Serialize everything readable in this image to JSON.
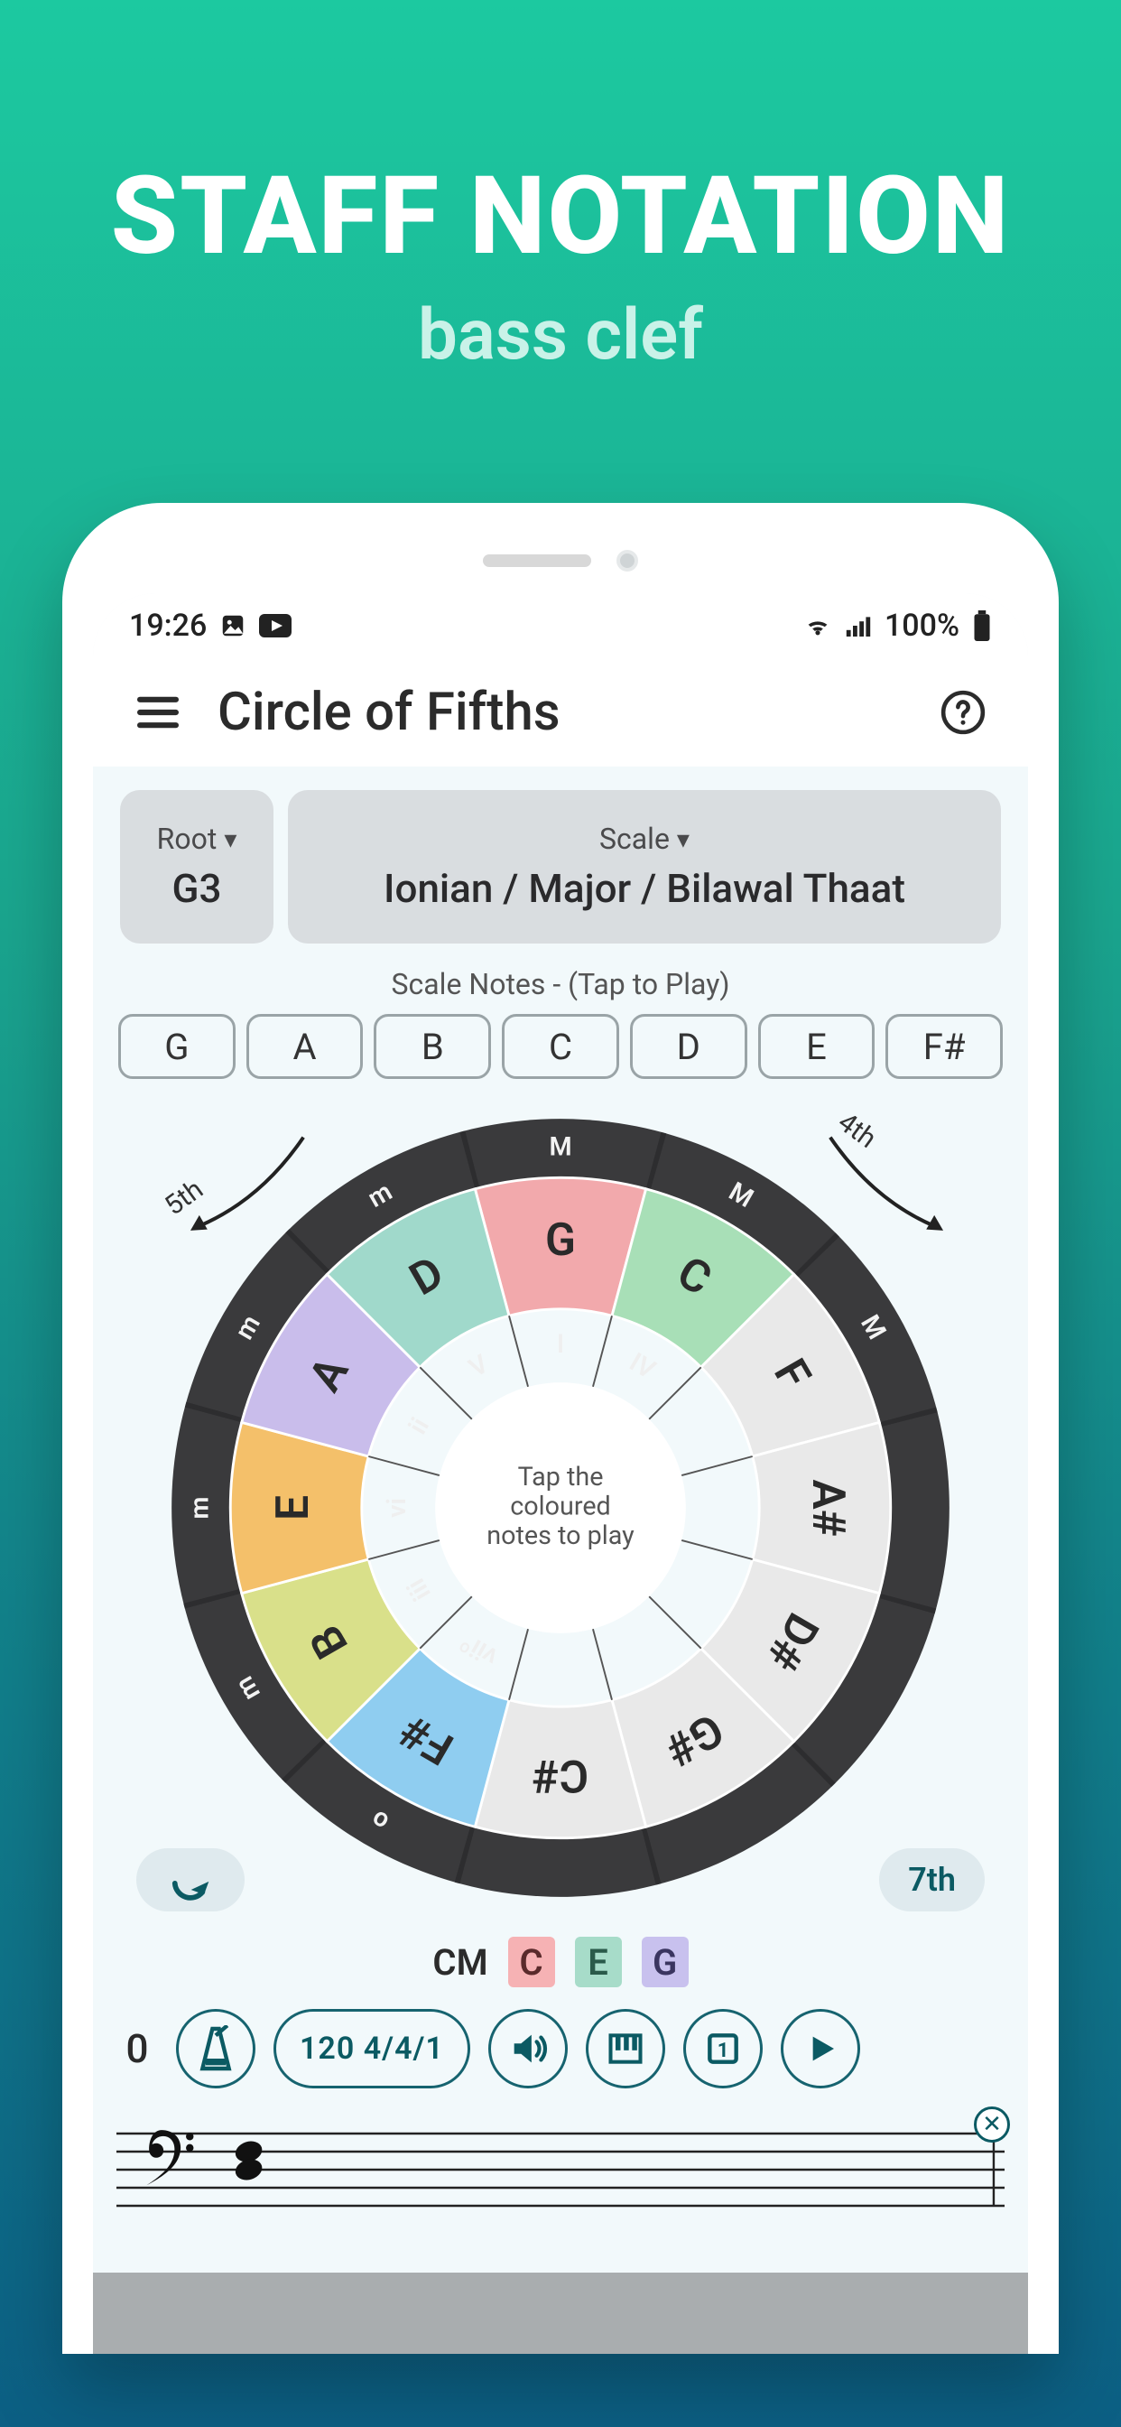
{
  "promo": {
    "title": "STAFF NOTATION",
    "subtitle": "bass clef"
  },
  "status": {
    "time": "19:26",
    "battery": "100%"
  },
  "appbar": {
    "title": "Circle of Fifths"
  },
  "selectors": {
    "root": {
      "label": "Root",
      "value": "G3"
    },
    "scale": {
      "label": "Scale",
      "value": "Ionian / Major / Bilawal Thaat"
    }
  },
  "scale_notes": {
    "label": "Scale Notes - (Tap to Play)",
    "notes": [
      "G",
      "A",
      "B",
      "C",
      "D",
      "E",
      "F#"
    ]
  },
  "circle": {
    "left_label": "5th",
    "right_label": "4th",
    "outer_quality": [
      "M",
      "M",
      "M",
      "",
      "",
      "",
      "",
      "o",
      "m",
      "m",
      "m",
      "m"
    ],
    "outer_notes": [
      "G",
      "C",
      "F",
      "A#",
      "D#",
      "G#",
      "C#",
      "F#",
      "B",
      "E",
      "A",
      "D"
    ],
    "inner_degrees": [
      "I",
      "IV",
      "",
      "",
      "",
      "",
      "",
      "viiº",
      "iii",
      "vi",
      "ii",
      "V"
    ],
    "outer_colors": [
      "#f2a9ac",
      "#a8dfb7",
      "#e9e9e9",
      "#e9e9e9",
      "#e9e9e9",
      "#e9e9e9",
      "#e9e9e9",
      "#8fcdf0",
      "#d9e08a",
      "#f4c06a",
      "#c9bdeb",
      "#a0d9cb"
    ],
    "center_text": "Tap the coloured notes to play"
  },
  "seventh_label": "7th",
  "chord": {
    "name": "CM",
    "notes": [
      "C",
      "E",
      "G"
    ]
  },
  "controls": {
    "count": "0",
    "tempo_sig": "120 4/4/1"
  }
}
